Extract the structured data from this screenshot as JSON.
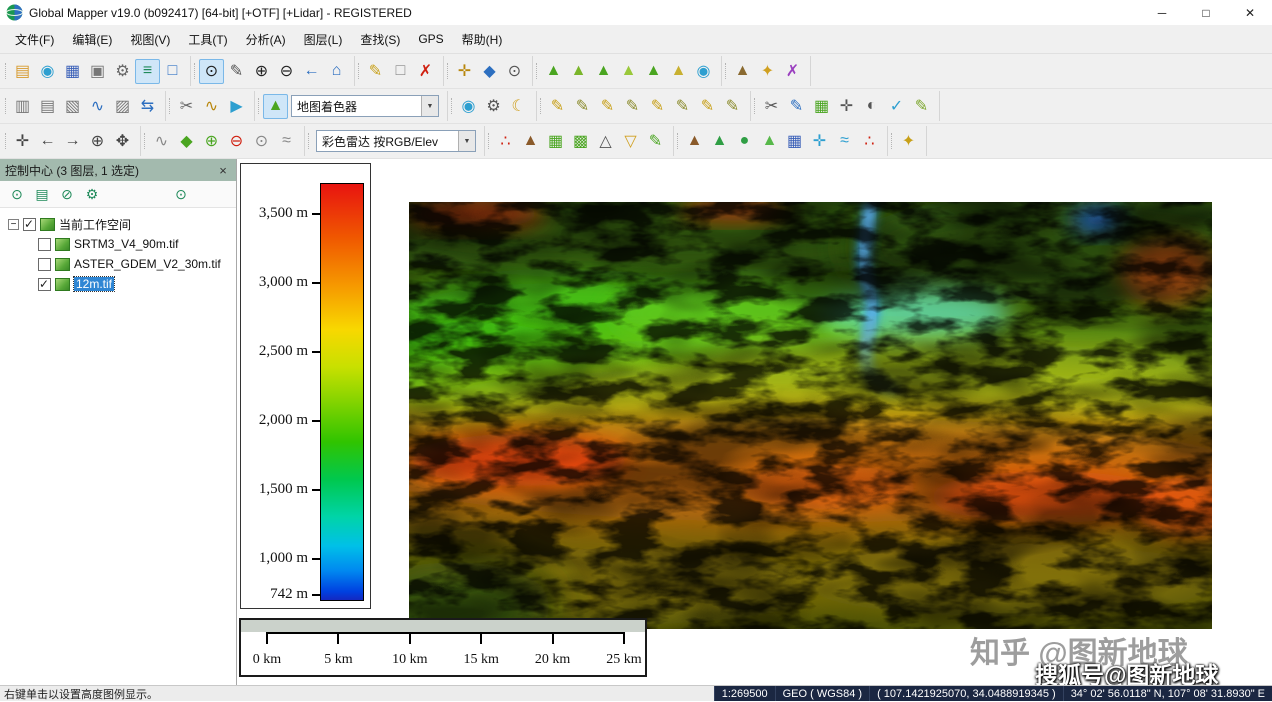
{
  "window": {
    "title": "Global Mapper v19.0 (b092417) [64-bit] [+OTF] [+Lidar] - REGISTERED",
    "controls": {
      "minimize": "─",
      "maximize": "□",
      "close": "✕"
    }
  },
  "colors": {
    "panel_header": "#a3baae",
    "selection": "#2f86d4",
    "status_bg": "#1b2742",
    "toolbar_highlight": "#cfe6f8"
  },
  "menu": {
    "items": [
      {
        "label": "文件(F)",
        "name": "file"
      },
      {
        "label": "编辑(E)",
        "name": "edit"
      },
      {
        "label": "视图(V)",
        "name": "view"
      },
      {
        "label": "工具(T)",
        "name": "tools"
      },
      {
        "label": "分析(A)",
        "name": "analysis"
      },
      {
        "label": "图层(L)",
        "name": "layer"
      },
      {
        "label": "查找(S)",
        "name": "search"
      },
      {
        "label": "GPS",
        "name": "gps"
      },
      {
        "label": "帮助(H)",
        "name": "help"
      }
    ]
  },
  "toolbars": {
    "rows": [
      {
        "groups": [
          {
            "icons": [
              {
                "n": "open-file",
                "g": "▤",
                "c": "#d79a2e"
              },
              {
                "n": "open-online-data",
                "g": "◉",
                "c": "#2d9fd0"
              },
              {
                "n": "save-workspace",
                "g": "▦",
                "c": "#3a60b8"
              },
              {
                "n": "print-map",
                "g": "▣",
                "c": "#777777"
              },
              {
                "n": "tools-config",
                "g": "⚙",
                "c": "#666666"
              },
              {
                "n": "control-center-toggle",
                "g": "≡",
                "c": "#1f8a5a",
                "hl": true
              },
              {
                "n": "map-layout",
                "g": "□",
                "c": "#3a78c8"
              }
            ]
          },
          {
            "icons": [
              {
                "n": "zoom-tool",
                "g": "⊙",
                "c": "#222222",
                "hl": true
              },
              {
                "n": "measure-tool",
                "g": "✎",
                "c": "#555555"
              },
              {
                "n": "zoom-in",
                "g": "⊕",
                "c": "#222222"
              },
              {
                "n": "zoom-out",
                "g": "⊖",
                "c": "#222222"
              },
              {
                "n": "previous-view",
                "g": "←",
                "c": "#2d6fc0"
              },
              {
                "n": "full-view-home",
                "g": "⌂",
                "c": "#2d6fc0"
              }
            ]
          },
          {
            "icons": [
              {
                "n": "digitizer-tool",
                "g": "✎",
                "c": "#c8a018"
              },
              {
                "n": "select-features",
                "g": "□",
                "c": "#888888"
              },
              {
                "n": "delete-feature",
                "g": "✗",
                "c": "#d02010"
              }
            ]
          },
          {
            "icons": [
              {
                "n": "coordinate-picker",
                "g": "✛",
                "c": "#b8860b"
              },
              {
                "n": "feature-info",
                "g": "◆",
                "c": "#2d6fc0"
              },
              {
                "n": "search-by-attribute",
                "g": "⊙",
                "c": "#555555"
              }
            ]
          },
          {
            "icons": [
              {
                "n": "elevation-legend",
                "g": "▲",
                "c": "#4aa520"
              },
              {
                "n": "create-contours",
                "g": "▲",
                "c": "#7ab52a"
              },
              {
                "n": "terrain-analysis",
                "g": "▲",
                "c": "#4aa520"
              },
              {
                "n": "view-shed",
                "g": "▲",
                "c": "#9ac83a"
              },
              {
                "n": "watershed",
                "g": "▲",
                "c": "#4aa520"
              },
              {
                "n": "raster-calculator",
                "g": "▲",
                "c": "#c8b030"
              },
              {
                "n": "water-rise",
                "g": "◉",
                "c": "#2d9fd0"
              }
            ]
          },
          {
            "icons": [
              {
                "n": "terrain-3d-view",
                "g": "▲",
                "c": "#8a6a30"
              },
              {
                "n": "quick-analysis",
                "g": "✦",
                "c": "#d0a020"
              },
              {
                "n": "close-analysis",
                "g": "✗",
                "c": "#9a3fbf"
              }
            ]
          }
        ]
      },
      {
        "groups": [
          {
            "icons": [
              {
                "n": "new-map-window",
                "g": "▥",
                "c": "#777777"
              },
              {
                "n": "tile-windows",
                "g": "▤",
                "c": "#777777"
              },
              {
                "n": "cascade-windows",
                "g": "▧",
                "c": "#777777"
              },
              {
                "n": "profile-view",
                "g": "∿",
                "c": "#2d6fc0"
              },
              {
                "n": "split-view",
                "g": "▨",
                "c": "#777777"
              },
              {
                "n": "link-views",
                "g": "⇆",
                "c": "#2d6fc0"
              }
            ]
          },
          {
            "icons": [
              {
                "n": "cut-profile",
                "g": "✂",
                "c": "#666666"
              },
              {
                "n": "path-profile",
                "g": "∿",
                "c": "#b8860b"
              },
              {
                "n": "fly-through",
                "g": "▶",
                "c": "#2d9fd0"
              }
            ]
          },
          {
            "icons": [
              {
                "n": "map-shader",
                "g": "▲",
                "c": "#4aa520",
                "hl": true
              }
            ],
            "combo": {
              "name": "shader-combo",
              "value": "地图着色器",
              "width": 148
            }
          },
          {
            "icons": [
              {
                "n": "projection-globe",
                "g": "◉",
                "c": "#2d9fd0"
              },
              {
                "n": "configuration-gear",
                "g": "⚙",
                "c": "#555555"
              },
              {
                "n": "day-night-mode",
                "g": "☾",
                "c": "#d0a020"
              }
            ]
          },
          {
            "icons": [
              {
                "n": "draw-point",
                "g": "✎",
                "c": "#c8a018"
              },
              {
                "n": "draw-line",
                "g": "✎",
                "c": "#8a8a2a"
              },
              {
                "n": "draw-area",
                "g": "✎",
                "c": "#c8a018"
              },
              {
                "n": "draw-rectangle",
                "g": "✎",
                "c": "#8a8a2a"
              },
              {
                "n": "draw-circle",
                "g": "✎",
                "c": "#c8a018"
              },
              {
                "n": "draw-range-ring",
                "g": "✎",
                "c": "#8a8a2a"
              },
              {
                "n": "draw-text",
                "g": "✎",
                "c": "#c8a018"
              },
              {
                "n": "draw-spline",
                "g": "✎",
                "c": "#8a8a2a"
              }
            ]
          },
          {
            "icons": [
              {
                "n": "edit-scissors",
                "g": "✂",
                "c": "#555555"
              },
              {
                "n": "attribute-editor",
                "g": "✎",
                "c": "#2d6fc0"
              },
              {
                "n": "create-grid",
                "g": "▦",
                "c": "#4aa520"
              },
              {
                "n": "move-feature",
                "g": "✛",
                "c": "#555555"
              },
              {
                "n": "rotate-feature",
                "g": "◐",
                "c": "#555555"
              },
              {
                "n": "verify-topology",
                "g": "✓",
                "c": "#2d9fd0"
              },
              {
                "n": "edit-vertices",
                "g": "✎",
                "c": "#7aa52a"
              }
            ]
          }
        ]
      },
      {
        "groups": [
          {
            "icons": [
              {
                "n": "pan-move",
                "g": "✛",
                "c": "#444444"
              },
              {
                "n": "shift-left",
                "g": "←",
                "c": "#444444"
              },
              {
                "n": "shift-right",
                "g": "→",
                "c": "#444444"
              },
              {
                "n": "center-view",
                "g": "⊕",
                "c": "#444444"
              },
              {
                "n": "drag-pan",
                "g": "✥",
                "c": "#444444"
              }
            ]
          },
          {
            "icons": [
              {
                "n": "line-tool",
                "g": "∿",
                "c": "#888888"
              },
              {
                "n": "vertex-move",
                "g": "◆",
                "c": "#4aa520"
              },
              {
                "n": "vertex-add",
                "g": "⊕",
                "c": "#4aa520"
              },
              {
                "n": "vertex-delete",
                "g": "⊖",
                "c": "#d02010"
              },
              {
                "n": "snap-toggle",
                "g": "⊙",
                "c": "#888888"
              },
              {
                "n": "smooth-line",
                "g": "≈",
                "c": "#888888"
              }
            ]
          },
          {
            "combo": {
              "name": "lidar-combo",
              "value": "彩色雷达 按RGB/Elev",
              "width": 160
            }
          },
          {
            "icons": [
              {
                "n": "lidar-points",
                "g": "∴",
                "c": "#d02010"
              },
              {
                "n": "lidar-ground",
                "g": "▲",
                "c": "#8a5a2a"
              },
              {
                "n": "lidar-grid",
                "g": "▦",
                "c": "#4aa520"
              },
              {
                "n": "lidar-classify",
                "g": "▩",
                "c": "#4aa520"
              },
              {
                "n": "lidar-noise",
                "g": "△",
                "c": "#555555"
              },
              {
                "n": "lidar-filter",
                "g": "▽",
                "c": "#d0a020"
              },
              {
                "n": "lidar-edit",
                "g": "✎",
                "c": "#4aa520"
              }
            ]
          },
          {
            "icons": [
              {
                "n": "ground-classify",
                "g": "▲",
                "c": "#8a5a2a"
              },
              {
                "n": "vegetation-classify",
                "g": "▲",
                "c": "#2f9e44"
              },
              {
                "n": "tree-extract",
                "g": "●",
                "c": "#2f9e44"
              },
              {
                "n": "canopy-model",
                "g": "▲",
                "c": "#57b84a"
              },
              {
                "n": "building-classify",
                "g": "▦",
                "c": "#3a60b8"
              },
              {
                "n": "powerline-classify",
                "g": "✛",
                "c": "#2d9fd0"
              },
              {
                "n": "water-classify",
                "g": "≈",
                "c": "#2d9fd0"
              },
              {
                "n": "point-colorize",
                "g": "∴",
                "c": "#d02010"
              }
            ]
          },
          {
            "icons": [
              {
                "n": "license-key",
                "g": "✦",
                "c": "#c8a018"
              }
            ]
          }
        ]
      }
    ]
  },
  "control_center": {
    "title": "控制中心 (3 图层,  1 选定)",
    "close": "×",
    "toolbar": [
      {
        "n": "zoom-to-layer",
        "g": "⊙",
        "c": "#1f8a5a"
      },
      {
        "n": "layer-metadata",
        "g": "▤",
        "c": "#1f8a5a"
      },
      {
        "n": "close-selected-layers",
        "g": "⊘",
        "c": "#1f8a5a"
      },
      {
        "n": "layer-options",
        "g": "⚙",
        "c": "#1f8a5a"
      },
      {
        "n": "search-vector-data",
        "g": "⊙",
        "c": "#1f8a5a",
        "gap": true
      }
    ]
  },
  "tree": {
    "root": {
      "label": "当前工作空间",
      "checked": true
    },
    "layers": [
      {
        "label": "SRTM3_V4_90m.tif",
        "checked": false,
        "selected": false
      },
      {
        "label": "ASTER_GDEM_V2_30m.tif",
        "checked": false,
        "selected": false
      },
      {
        "label": "12m.tif",
        "checked": true,
        "selected": true
      }
    ]
  },
  "legend": {
    "entries": [
      {
        "label": "3,500 m",
        "pos": 7.5
      },
      {
        "label": "3,000 m",
        "pos": 24
      },
      {
        "label": "2,500 m",
        "pos": 40.5
      },
      {
        "label": "2,000 m",
        "pos": 57
      },
      {
        "label": "1,500 m",
        "pos": 73.5
      },
      {
        "label": "1,000 m",
        "pos": 90
      },
      {
        "label": "742 m",
        "pos": 98.5
      }
    ],
    "gradient": [
      "#e81410 0%",
      "#f05800 13%",
      "#f69c00 25%",
      "#f8d800 35%",
      "#c8e000 44%",
      "#86d400 52%",
      "#30c400 62%",
      "#00c84e 71%",
      "#00d4a8 80%",
      "#00c0e8 87%",
      "#0088f0 93%",
      "#0040e0 98%",
      "#1428c0 100%"
    ]
  },
  "scale_bar": {
    "labels": [
      "0 km",
      "5 km",
      "10 km",
      "15 km",
      "20 km",
      "25 km"
    ]
  },
  "status_bar": {
    "left": "右键单击以设置高度图例显示。",
    "cells": [
      {
        "name": "scale",
        "text": "1:269500"
      },
      {
        "name": "projection",
        "text": "GEO ( WGS84 )"
      },
      {
        "name": "coordinates",
        "text": "( 107.1421925070, 34.0488919345 )"
      },
      {
        "name": "position-dms",
        "text": "34° 02' 56.0118\" N, 107° 08' 31.8930\" E"
      }
    ]
  },
  "watermarks": {
    "zhihu": "知乎 @图新地球",
    "sohu": "搜狐号@图新地球"
  }
}
